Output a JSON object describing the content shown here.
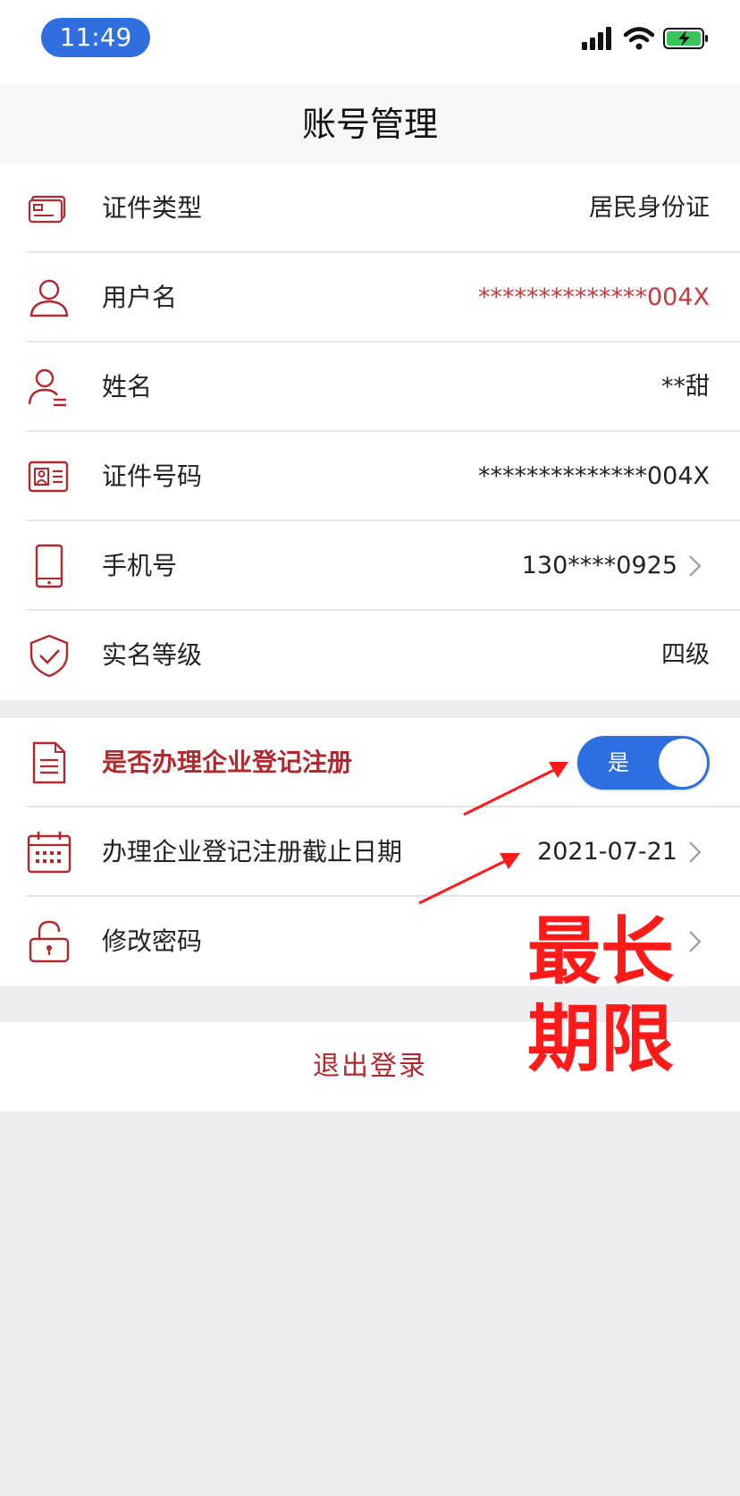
{
  "status_bar": {
    "time": "11:49"
  },
  "nav": {
    "title": "账号管理"
  },
  "rows": [
    {
      "label": "证件类型",
      "value": "居民身份证"
    },
    {
      "label": "用户名",
      "value": "**************004X"
    },
    {
      "label": "姓名",
      "value": "**甜"
    },
    {
      "label": "证件号码",
      "value": "**************004X"
    },
    {
      "label": "手机号",
      "value": "130****0925"
    },
    {
      "label": "实名等级",
      "value": "四级"
    }
  ],
  "enterprise": {
    "register_label": "是否办理企业登记注册",
    "toggle_label": "是",
    "toggle_on": true,
    "deadline_label": "办理企业登记注册截止日期",
    "deadline_value": "2021-07-21",
    "password_label": "修改密码"
  },
  "logout": {
    "label": "退出登录"
  },
  "annotation": {
    "text": "最长期限",
    "color": "#ff1a1a"
  },
  "colors": {
    "accent_red": "#b3282d",
    "toggle_blue": "#2d6fe3",
    "status_pill": "#2f6fe0"
  }
}
